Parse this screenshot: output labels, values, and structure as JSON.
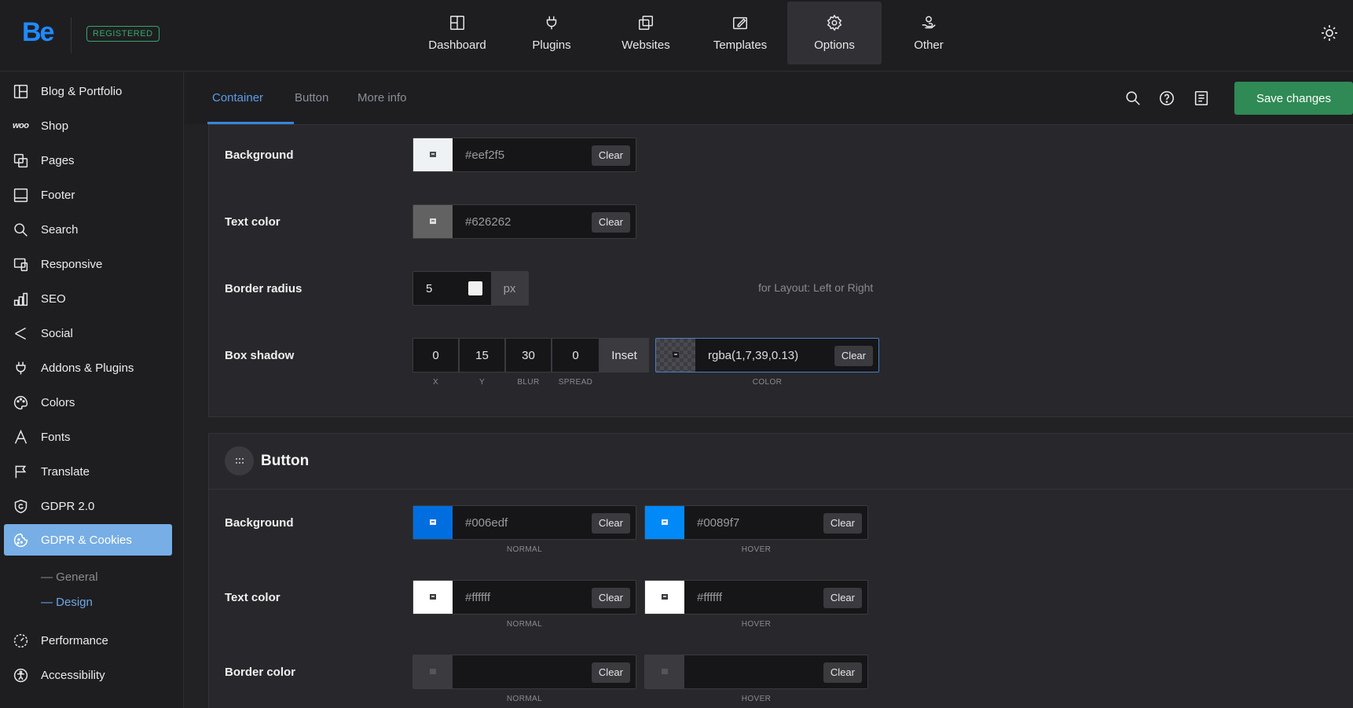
{
  "brand": {
    "logo": "Be",
    "badge": "REGISTERED"
  },
  "topnav": [
    {
      "label": "Dashboard",
      "icon": "dashboard-icon"
    },
    {
      "label": "Plugins",
      "icon": "plug-icon"
    },
    {
      "label": "Websites",
      "icon": "websites-icon"
    },
    {
      "label": "Templates",
      "icon": "templates-icon"
    },
    {
      "label": "Options",
      "icon": "gear-icon",
      "active": true
    },
    {
      "label": "Other",
      "icon": "hand-icon"
    }
  ],
  "sidebar": {
    "items": [
      {
        "label": "Blog & Portfolio",
        "icon": "layout-icon"
      },
      {
        "label": "Shop",
        "icon": "woo-icon"
      },
      {
        "label": "Pages",
        "icon": "pages-icon"
      },
      {
        "label": "Footer",
        "icon": "footer-icon"
      },
      {
        "label": "Search",
        "icon": "search-icon"
      },
      {
        "label": "Responsive",
        "icon": "responsive-icon"
      },
      {
        "label": "SEO",
        "icon": "chart-icon"
      },
      {
        "label": "Social",
        "icon": "share-icon"
      },
      {
        "label": "Addons & Plugins",
        "icon": "plug-icon"
      },
      {
        "label": "Colors",
        "icon": "palette-icon"
      },
      {
        "label": "Fonts",
        "icon": "font-icon"
      },
      {
        "label": "Translate",
        "icon": "flag-icon"
      },
      {
        "label": "GDPR 2.0",
        "icon": "shield-icon"
      },
      {
        "label": "GDPR & Cookies",
        "icon": "cookie-icon",
        "active": true
      },
      {
        "label": "Performance",
        "icon": "performance-icon"
      },
      {
        "label": "Accessibility",
        "icon": "accessibility-icon"
      }
    ],
    "sub": [
      {
        "label": "General"
      },
      {
        "label": "Design",
        "current": true
      }
    ],
    "woo_mark": "woo"
  },
  "tabs": [
    {
      "label": "Container",
      "active": true
    },
    {
      "label": "Button"
    },
    {
      "label": "More info"
    }
  ],
  "toolbar": {
    "save_label": "Save changes"
  },
  "container": {
    "background": {
      "label": "Background",
      "value": "#eef2f5",
      "swatch": "#eef2f5",
      "clear": "Clear"
    },
    "text_color": {
      "label": "Text color",
      "value": "#626262",
      "swatch": "#626262",
      "clear": "Clear"
    },
    "border_radius": {
      "label": "Border radius",
      "value": "5",
      "unit": "px",
      "hint": "for Layout: Left or Right"
    },
    "box_shadow": {
      "label": "Box shadow",
      "x": "0",
      "y": "15",
      "blur": "30",
      "spread": "0",
      "x_caption": "X",
      "y_caption": "Y",
      "blur_caption": "BLUR",
      "spread_caption": "SPREAD",
      "inset": "Inset",
      "color": "rgba(1,7,39,0.13)",
      "color_caption": "COLOR",
      "clear": "Clear"
    }
  },
  "button_section": {
    "title": "Button",
    "background": {
      "label": "Background",
      "normal": {
        "value": "#006edf",
        "swatch": "#006edf",
        "clear": "Clear",
        "caption": "NORMAL"
      },
      "hover": {
        "value": "#0089f7",
        "swatch": "#0089f7",
        "clear": "Clear",
        "caption": "HOVER"
      }
    },
    "text_color": {
      "label": "Text color",
      "normal": {
        "value": "#ffffff",
        "swatch": "#ffffff",
        "clear": "Clear",
        "caption": "NORMAL"
      },
      "hover": {
        "value": "#ffffff",
        "swatch": "#ffffff",
        "clear": "Clear",
        "caption": "HOVER"
      }
    },
    "border_color": {
      "label": "Border color",
      "normal": {
        "value": "",
        "clear": "Clear",
        "caption": "NORMAL"
      },
      "hover": {
        "value": "",
        "clear": "Clear",
        "caption": "HOVER"
      }
    }
  }
}
